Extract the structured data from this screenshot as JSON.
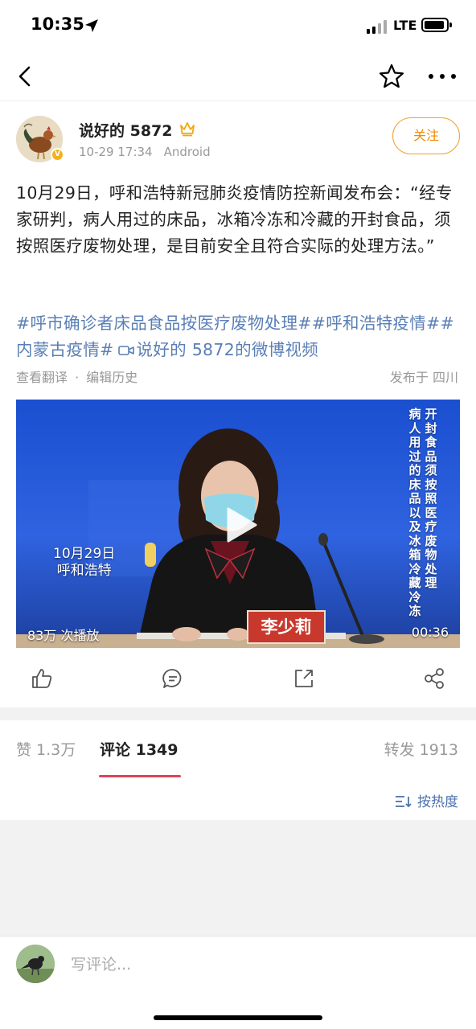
{
  "status_bar": {
    "time": "10:35",
    "network": "LTE"
  },
  "nav": {
    "back_icon": "chevron-left-icon",
    "favorite_icon": "star-icon",
    "more_icon": "more-dots-icon"
  },
  "author": {
    "name": "说好的 5872",
    "time": "10-29 17:34",
    "device": "Android",
    "follow_label": "关注",
    "badge": "V"
  },
  "post": {
    "text": "10月29日，呼和浩特新冠肺炎疫情防控新闻发布会：“经专家研判，病人用过的床品，冰箱冷冻和冷藏的开封食品，须按照医疗废物处理，是目前安全且符合实际的处理方法。”",
    "tags": "#呼市确诊者床品食品按医疗废物处理##呼和浩特疫情##内蒙古疫情#",
    "video_link": "说好的 5872的微博视频",
    "translate": "查看翻译",
    "separator": "·",
    "edit_history": "编辑历史",
    "location": "发布于 四川"
  },
  "video": {
    "date_line1": "10月29日",
    "date_line2": "呼和浩特",
    "caption_col1": "开封食品须按照医疗废物处理",
    "caption_col2": "病人用过的床品以及冰箱冷藏冷冻",
    "speaker_name": "李少莉",
    "views": "83万 次播放",
    "duration": "00:36"
  },
  "actions": [
    "thumbs-up-icon",
    "comment-icon",
    "share-external-icon",
    "share-icon"
  ],
  "tabs": {
    "likes": "赞 1.3万",
    "comments": "评论 1349",
    "reposts": "转发 1913"
  },
  "sort_label": "按热度",
  "comment_input": {
    "placeholder": "写评论..."
  },
  "colors": {
    "accent": "#f08a00",
    "link": "#5a7fb5",
    "tab_underline": "#e0425a"
  }
}
